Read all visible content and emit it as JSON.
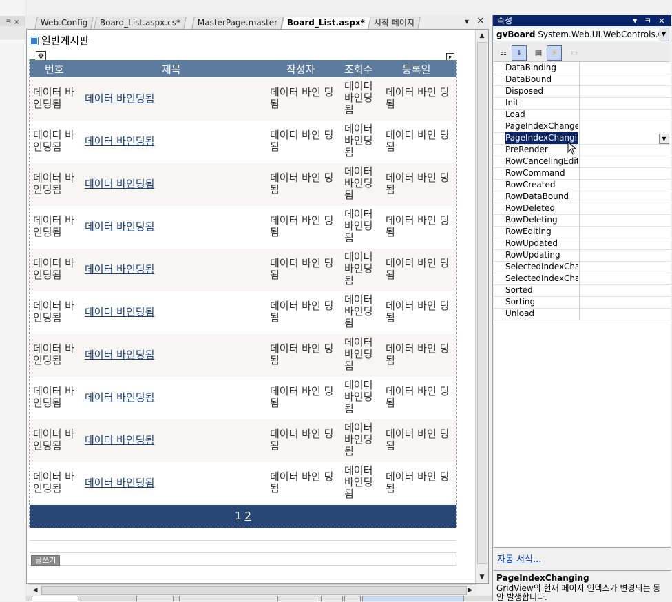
{
  "left_panel": {
    "header_controls": "ㅋ ×"
  },
  "editor": {
    "tabs": [
      "Web.Config",
      "Board_List.aspx.cs*",
      "MasterPage.master",
      "Board_List.aspx*",
      "시작 페이지"
    ],
    "active_tab_index": 3,
    "tab_controls": {
      "dropdown": "▾",
      "close": "×"
    },
    "page_title": "일반게시판",
    "grid": {
      "headers": [
        "번호",
        "제목",
        "작성자",
        "조회수",
        "등록일"
      ],
      "cell_text": "데이터 바인딩됨",
      "rows": [
        {
          "no": "데이터 바인딩됨",
          "title": "데이터 바인딩됨",
          "writer": "데이터 바인 딩됨",
          "views": "데이터 바인딩 됨",
          "date": "데이터 바인 딩됨"
        },
        {
          "no": "데이터 바인딩됨",
          "title": "데이터 바인딩됨",
          "writer": "데이터 바인 딩됨",
          "views": "데이터 바인딩 됨",
          "date": "데이터 바인 딩됨"
        },
        {
          "no": "데이터 바인딩됨",
          "title": "데이터 바인딩됨",
          "writer": "데이터 바인 딩됨",
          "views": "데이터 바인딩 됨",
          "date": "데이터 바인 딩됨"
        },
        {
          "no": "데이터 바인딩됨",
          "title": "데이터 바인딩됨",
          "writer": "데이터 바인 딩됨",
          "views": "데이터 바인딩 됨",
          "date": "데이터 바인 딩됨"
        },
        {
          "no": "데이터 바인딩됨",
          "title": "데이터 바인딩됨",
          "writer": "데이터 바인 딩됨",
          "views": "데이터 바인딩 됨",
          "date": "데이터 바인 딩됨"
        },
        {
          "no": "데이터 바인딩됨",
          "title": "데이터 바인딩됨",
          "writer": "데이터 바인 딩됨",
          "views": "데이터 바인딩 됨",
          "date": "데이터 바인 딩됨"
        },
        {
          "no": "데이터 바인딩됨",
          "title": "데이터 바인딩됨",
          "writer": "데이터 바인 딩됨",
          "views": "데이터 바인딩 됨",
          "date": "데이터 바인 딩됨"
        },
        {
          "no": "데이터 바인딩됨",
          "title": "데이터 바인딩됨",
          "writer": "데이터 바인 딩됨",
          "views": "데이터 바인딩 됨",
          "date": "데이터 바인 딩됨"
        },
        {
          "no": "데이터 바인딩됨",
          "title": "데이터 바인딩됨",
          "writer": "데이터 바인 딩됨",
          "views": "데이터 바인딩 됨",
          "date": "데이터 바인 딩됨"
        },
        {
          "no": "데이터 바인딩됨",
          "title": "데이터 바인딩됨",
          "writer": "데이터 바인 딩됨",
          "views": "데이터 바인딩 됨",
          "date": "데이터 바인 딩됨"
        }
      ],
      "pager": {
        "page1": "1",
        "page2": "2"
      },
      "header_color": "#5d7b9d",
      "pager_color": "#284775"
    },
    "write_button": "글쓰기"
  },
  "properties": {
    "panel_title": "속성",
    "panel_controls": "▾ ㅋ ×",
    "object_name": "gvBoard",
    "object_type": "System.Web.UI.WebControls.Gr",
    "toolbar_icons": [
      "categorized-icon",
      "alphabetical-icon",
      "properties-icon",
      "events-icon",
      "property-pages-icon"
    ],
    "events": [
      "DataBinding",
      "DataBound",
      "Disposed",
      "Init",
      "Load",
      "PageIndexChange",
      "PageIndexChangin",
      "PreRender",
      "RowCancelingEdit",
      "RowCommand",
      "RowCreated",
      "RowDataBound",
      "RowDeleted",
      "RowDeleting",
      "RowEditing",
      "RowUpdated",
      "RowUpdating",
      "SelectedIndexChan",
      "SelectedIndexChan",
      "Sorted",
      "Sorting",
      "Unload"
    ],
    "selected_event_index": 6,
    "verb_link": "자동 서식...",
    "description_title": "PageIndexChanging",
    "description_text": "GridView의 현재 페이지 인덱스가 변경되는 동안 발생합니다.",
    "selection_color": "#0a246a"
  }
}
